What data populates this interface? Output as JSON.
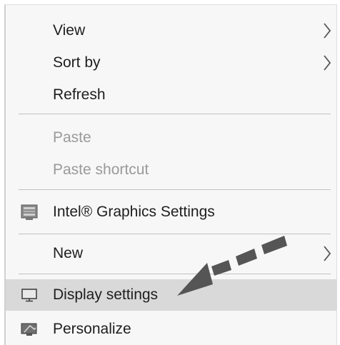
{
  "menu": {
    "items": [
      {
        "label": "View",
        "submenu": true
      },
      {
        "label": "Sort by",
        "submenu": true
      },
      {
        "label": "Refresh"
      },
      {
        "label": "Paste",
        "disabled": true
      },
      {
        "label": "Paste shortcut",
        "disabled": true
      },
      {
        "label": "Intel® Graphics Settings",
        "icon": "intel-graphics-icon"
      },
      {
        "label": "New",
        "submenu": true
      },
      {
        "label": "Display settings",
        "icon": "display-monitor-icon",
        "highlighted": true
      },
      {
        "label": "Personalize",
        "icon": "personalize-icon"
      }
    ]
  },
  "annotation": {
    "arrow_icon": "dashed-pointer-arrow",
    "arrow_color": "#555555"
  },
  "colors": {
    "menu_background": "#f7f7f7",
    "highlight": "#d9d9d9",
    "separator": "#c2c2c2",
    "disabled_text": "#9a9a9a"
  }
}
